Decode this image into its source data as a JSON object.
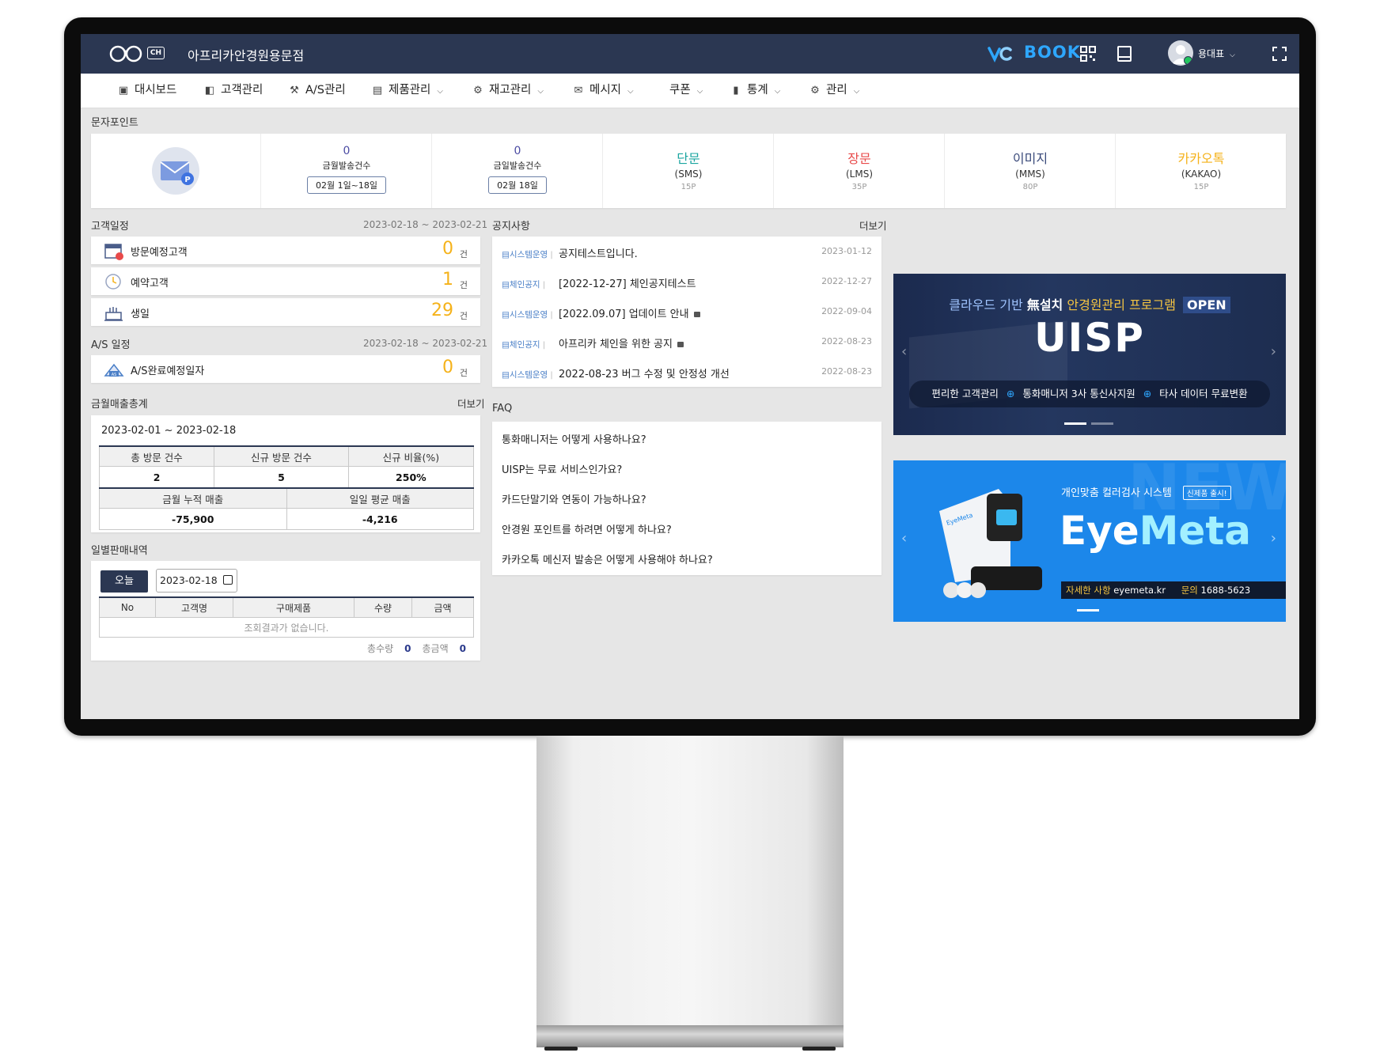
{
  "header": {
    "store_name": "아프리카안경원용문점",
    "ch_badge": "CH",
    "book_label": "BOOK",
    "user_name": "용대표",
    "colors": {
      "topbar": "#2b3752",
      "accent": "#2ea7ff"
    }
  },
  "nav": {
    "items": [
      {
        "label": "대시보드",
        "icon": "monitor-icon"
      },
      {
        "label": "고객관리",
        "icon": "book-icon"
      },
      {
        "label": "A/S관리",
        "icon": "wrench-icon"
      },
      {
        "label": "제품관리",
        "icon": "printer-icon"
      },
      {
        "label": "재고관리",
        "icon": "gear-icon"
      },
      {
        "label": "메시지",
        "icon": "mail-icon"
      },
      {
        "label": "쿠폰",
        "icon": "coupon-icon"
      },
      {
        "label": "통계",
        "icon": "bar-chart-icon"
      },
      {
        "label": "관리",
        "icon": "gear-icon"
      }
    ]
  },
  "points": {
    "title": "문자포인트",
    "monthly": {
      "count": "0",
      "label": "금월발송건수",
      "range": "02월 1일~18일"
    },
    "daily": {
      "count": "0",
      "label": "금일발송건수",
      "range": "02월 18일"
    },
    "types": [
      {
        "name": "단문",
        "code": "(SMS)",
        "price": "15P",
        "color": "#1aa5a0"
      },
      {
        "name": "장문",
        "code": "(LMS)",
        "price": "35P",
        "color": "#e84a4a"
      },
      {
        "name": "이미지",
        "code": "(MMS)",
        "price": "80P",
        "color": "#3a4a7a"
      },
      {
        "name": "카카오톡",
        "code": "(KAKAO)",
        "price": "15P",
        "color": "#f5b21a"
      }
    ]
  },
  "schedule": {
    "title": "고객일정",
    "range": "2023-02-18 ~ 2023-02-21",
    "rows": [
      {
        "label": "방문예정고객",
        "value": "0",
        "unit": "건"
      },
      {
        "label": "예약고객",
        "value": "1",
        "unit": "건"
      },
      {
        "label": "생일",
        "value": "29",
        "unit": "건"
      }
    ]
  },
  "as_schedule": {
    "title": "A/S 일정",
    "range": "2023-02-18 ~ 2023-02-21",
    "rows": [
      {
        "label": "A/S완료예정일자",
        "value": "0",
        "unit": "건"
      }
    ]
  },
  "sales": {
    "title": "금월매출총계",
    "more": "더보기",
    "period": "2023-02-01 ~ 2023-02-18",
    "headers1": [
      "총 방문 건수",
      "신규 방문 건수",
      "신규 비율(%)"
    ],
    "values1": [
      "2",
      "5",
      "250%"
    ],
    "headers2": [
      "금월 누적 매출",
      "일일 평균 매출"
    ],
    "values2": [
      "-75,900",
      "-4,216"
    ]
  },
  "daily_sales": {
    "title": "일별판매내역",
    "today_button": "오늘",
    "date": "2023-02-18",
    "columns": [
      "No",
      "고객명",
      "구매제품",
      "수량",
      "금액"
    ],
    "empty": "조회결과가 없습니다.",
    "total_qty_label": "총수량",
    "total_qty": "0",
    "total_amt_label": "총금액",
    "total_amt": "0"
  },
  "notices": {
    "title": "공지사항",
    "more": "더보기",
    "items": [
      {
        "category": "시스템운영",
        "title": "공지테스트입니다.",
        "date": "2023-01-12",
        "locked": false
      },
      {
        "category": "체인공지",
        "title": "[2022-12-27] 체인공지테스트",
        "date": "2022-12-27",
        "locked": false
      },
      {
        "category": "시스템운영",
        "title": "[2022.09.07] 업데이트 안내",
        "date": "2022-09-04",
        "locked": true
      },
      {
        "category": "체인공지",
        "title": "아프리카 체인을 위한 공지",
        "date": "2022-08-23",
        "locked": true
      },
      {
        "category": "시스템운영",
        "title": "2022-08-23 버그 수정 및 안정성 개선",
        "date": "2022-08-23",
        "locked": false
      }
    ]
  },
  "faq": {
    "title": "FAQ",
    "items": [
      "통화매니저는 어떻게 사용하나요?",
      "UISP는 무료 서비스인가요?",
      "카드단말기와 연동이 가능하나요?",
      "안경원 포인트를 하려면 어떻게 하나요?",
      "카카오톡 메신저 발송은 어떻게 사용해야 하나요?"
    ]
  },
  "banner1": {
    "headline_a": "클라우드 기반 ",
    "headline_b": "無설치",
    "headline_c": " 안경원관리 프로그램",
    "open_badge": "OPEN",
    "brand": "UISP",
    "features": [
      "편리한 고객관리",
      "통화매니저 3사 통신사지원",
      "타사 데이터 무료변환"
    ]
  },
  "banner2": {
    "tagline": "개인맞춤 컬러검사 시스템",
    "new_badge": "신제품 출시!",
    "brand_a": "Eye",
    "brand_b": "Meta",
    "watermark": "NEW",
    "info_label": "자세한 사항",
    "site": "eyemeta.kr",
    "phone_label": "문의",
    "phone": "1688-5623",
    "device_brand": "EyeMeta"
  }
}
